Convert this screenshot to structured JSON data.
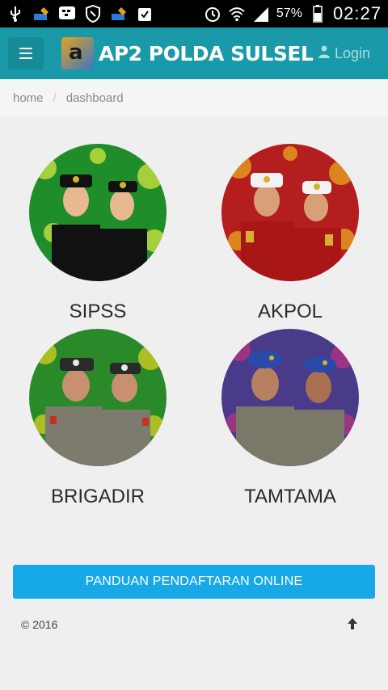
{
  "statusbar": {
    "battery": "57%",
    "time": "02:27"
  },
  "navbar": {
    "title": "AP2 POLDA SULSEL",
    "login": "Login"
  },
  "breadcrumb": {
    "home": "home",
    "current": "dashboard"
  },
  "cards": [
    {
      "label": "SIPSS",
      "bg": "#1f8d2a",
      "accent": "#c8e040",
      "uniform": "#111111"
    },
    {
      "label": "AKPOL",
      "bg": "#b51e1e",
      "accent": "#e8a820",
      "uniform": "#b01a1a"
    },
    {
      "label": "BRIGADIR",
      "bg": "#2a8a2a",
      "accent": "#d8d020",
      "uniform": "#7d7a6e"
    },
    {
      "label": "TAMTAMA",
      "bg": "#4a3a8a",
      "accent": "#c03080",
      "uniform": "#7a7868"
    }
  ],
  "guide_button": "PANDUAN PENDAFTARAN ONLINE",
  "footer": {
    "copyright": "© 2016"
  }
}
